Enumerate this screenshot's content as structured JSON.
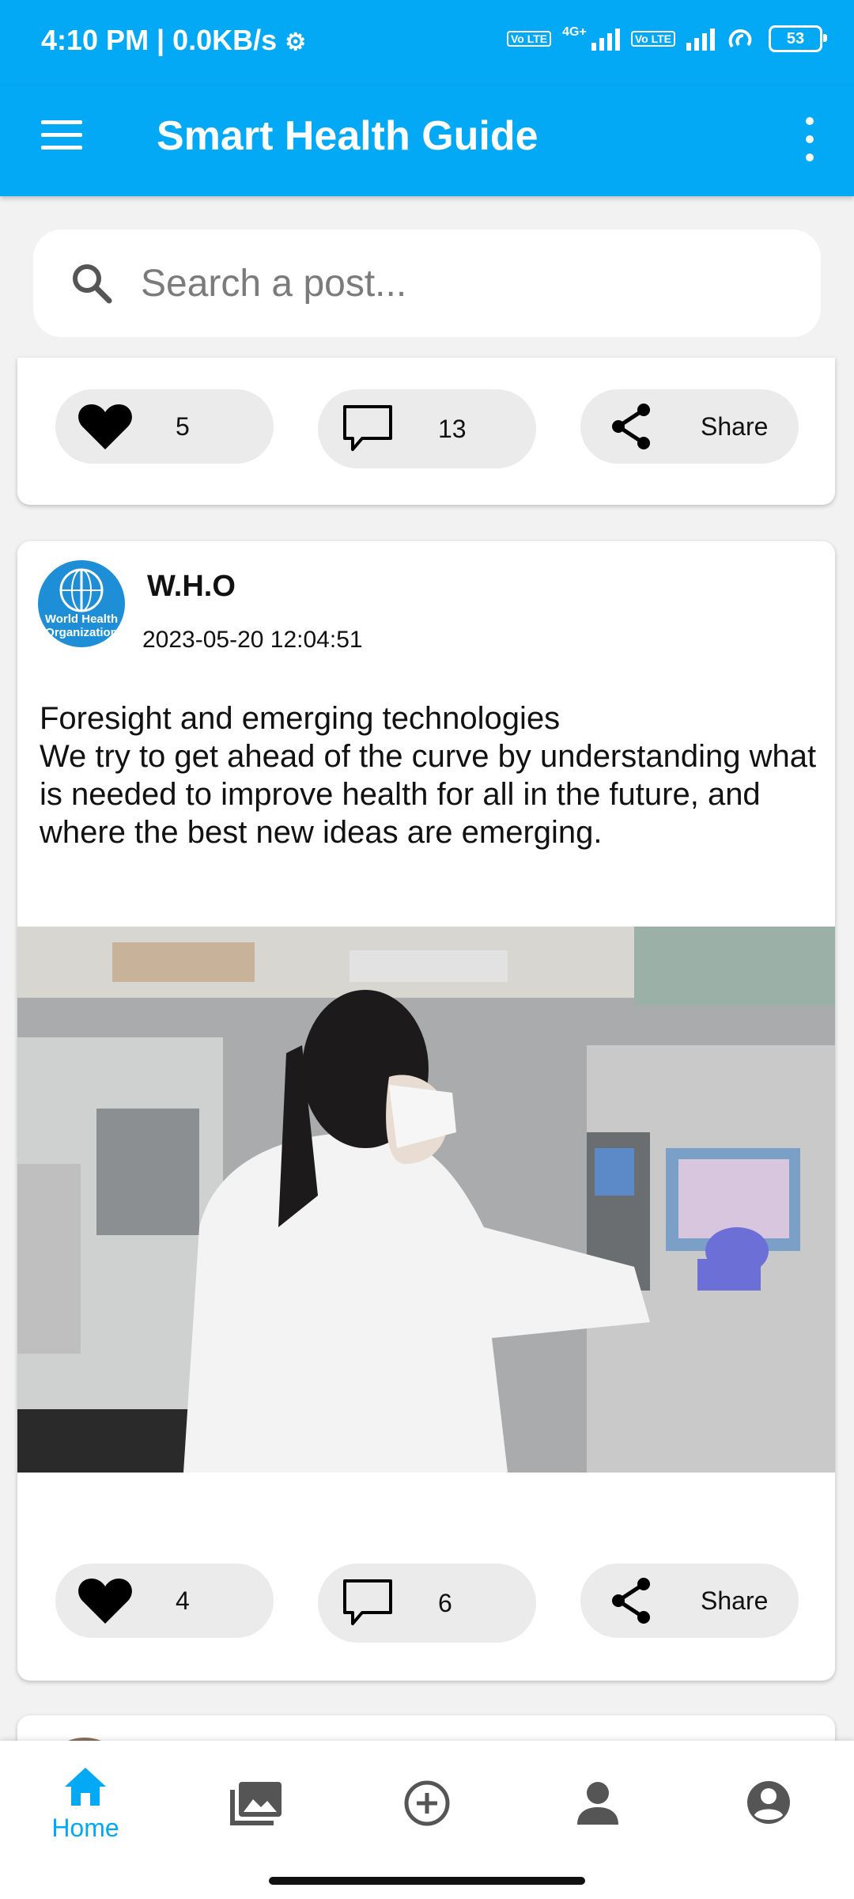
{
  "status_bar": {
    "time_speed": "4:10 PM | 0.0KB/s",
    "network": "4G+",
    "lte": "Vo LTE",
    "battery": "53"
  },
  "app_bar": {
    "title": "Smart Health Guide"
  },
  "search": {
    "placeholder": "Search a post..."
  },
  "posts": [
    {
      "likes": "5",
      "comments": "13",
      "share_label": "Share"
    },
    {
      "author": "W.H.O",
      "avatar_text": "World Health Organization",
      "timestamp": "2023-05-20 12:04:51",
      "body": "Foresight and emerging technologies\nWe try to get ahead of the curve by understanding what is needed to improve health for all in the future, and where the best new ideas are emerging.",
      "likes": "4",
      "comments": "6",
      "share_label": "Share"
    }
  ],
  "bottom_nav": {
    "home_label": "Home",
    "active": "home"
  },
  "colors": {
    "primary": "#03a9f4",
    "pill_bg": "#ebebeb"
  }
}
